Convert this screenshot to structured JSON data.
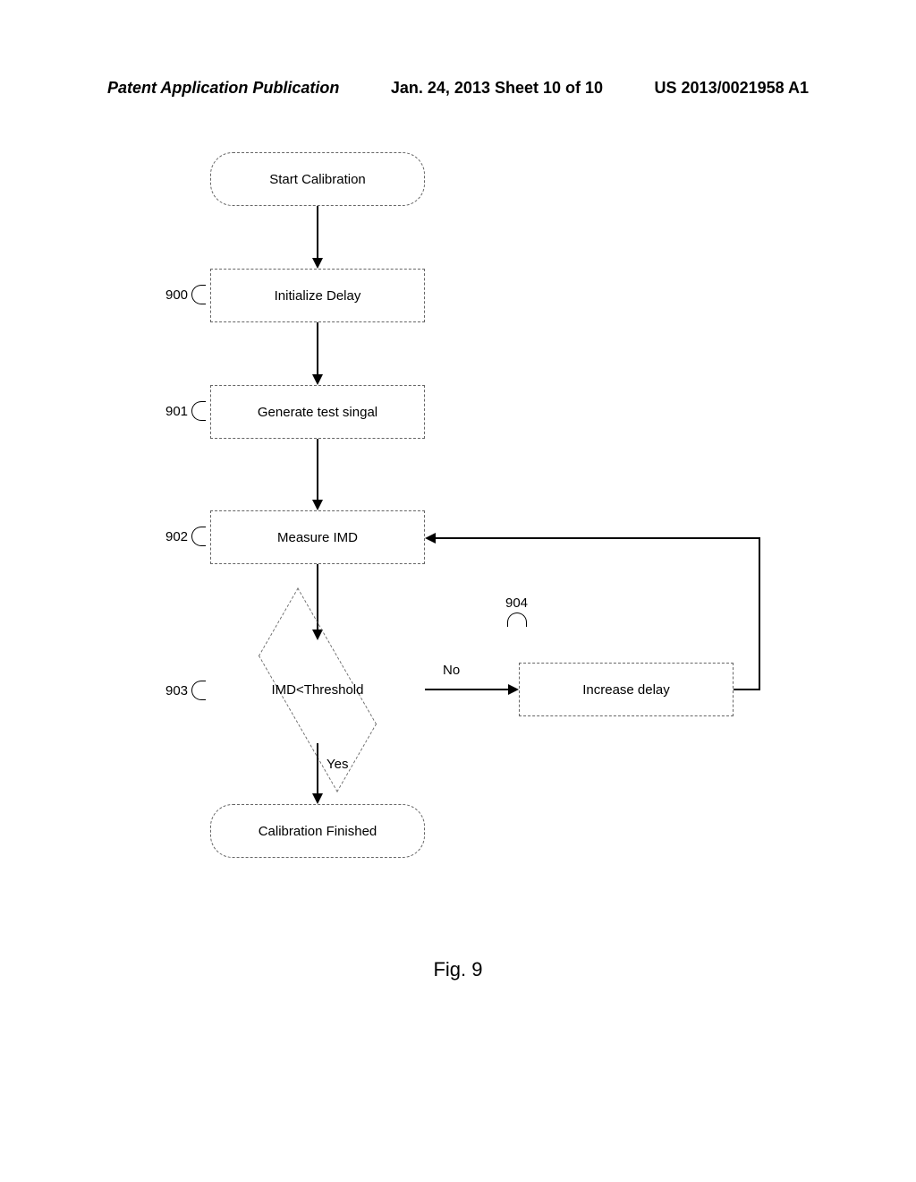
{
  "header": {
    "left": "Patent Application Publication",
    "center": "Jan. 24, 2013  Sheet 10 of 10",
    "right": "US 2013/0021958 A1"
  },
  "flowchart": {
    "start": "Start Calibration",
    "step900": "Initialize Delay",
    "step901": "Generate test singal",
    "step902": "Measure IMD",
    "decision903": "IMD<Threshold",
    "step904": "Increase delay",
    "end": "Calibration Finished",
    "labels": {
      "ref900": "900",
      "ref901": "901",
      "ref902": "902",
      "ref903": "903",
      "ref904": "904",
      "no": "No",
      "yes": "Yes"
    }
  },
  "caption": "Fig. 9"
}
